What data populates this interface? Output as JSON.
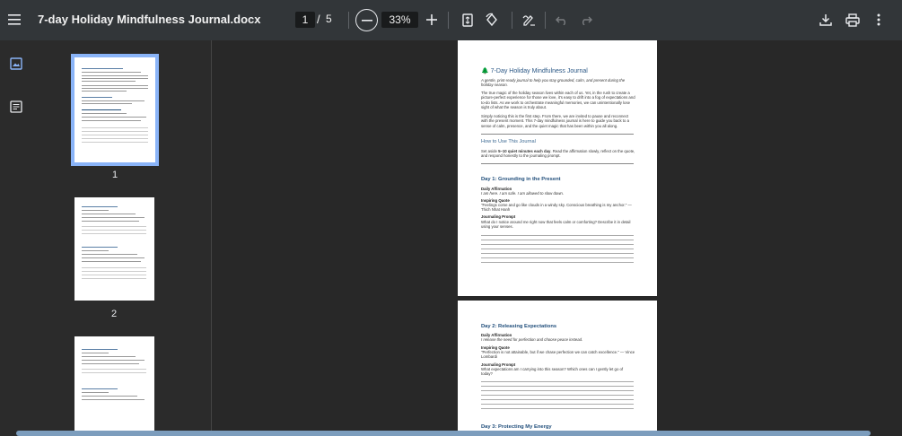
{
  "toolbar": {
    "title": "7-day Holiday Mindfulness Journal.docx",
    "current_page": "1",
    "page_separator": "/",
    "total_pages": "5",
    "zoom": "33%"
  },
  "sidebar": {
    "thumbnails": [
      {
        "label": "1"
      },
      {
        "label": "2"
      }
    ]
  },
  "page1": {
    "title": "🌲 7-Day Holiday Mindfulness Journal",
    "subtitle": "A gentle, print-ready journal to help you stay grounded, calm, and present during the holiday season.",
    "para1": "The true magic of the holiday season lives within each of us. Yet, in the rush to create a picture-perfect experience for those we love, it's easy to drift into a fog of expectations and to-do lists. As we work to orchestrate meaningful memories, we can unintentionally lose sight of what the season is truly about.",
    "para2": "Simply noticing this is the first step. From there, we are invited to pause and reconnect with the present moment. This 7-day mindfulness journal is here to guide you back to a sense of calm, presence, and the quiet magic that has been within you all along.",
    "howto_heading": "How to Use This Journal",
    "howto_text_prefix": "Set aside ",
    "howto_text_bold": "5–10 quiet minutes each day",
    "howto_text_suffix": ". Read the affirmation slowly, reflect on the quote, and respond honestly to the journaling prompt.",
    "day1_heading": "Day 1: Grounding in the Present",
    "affirmation_label": "Daily Affirmation",
    "day1_affirmation": "I am here. I am safe. I am allowed to slow down.",
    "quote_label": "Inspiring Quote",
    "day1_quote": "\"Feelings come and go like clouds in a windy sky. Conscious breathing is my anchor.\" — Thich Nhat Hanh",
    "prompt_label": "Journaling Prompt",
    "day1_prompt": "What do I notice around me right now that feels calm or comforting? Describe it in detail using your senses."
  },
  "page2": {
    "day2_heading": "Day 2: Releasing Expectations",
    "affirmation_label": "Daily Affirmation",
    "day2_affirmation": "I release the need for perfection and choose peace instead.",
    "quote_label": "Inspiring Quote",
    "day2_quote": "\"Perfection is not attainable, but if we chase perfection we can catch excellence.\" — Vince Lombardi",
    "prompt_label": "Journaling Prompt",
    "day2_prompt": "What expectations am I carrying into this season? Which ones can I gently let go of today?",
    "day3_heading": "Day 3: Protecting My Energy"
  }
}
